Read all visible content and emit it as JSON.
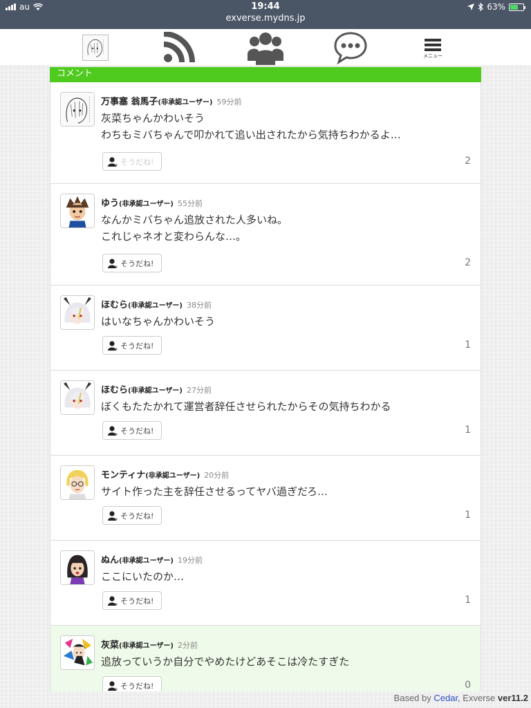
{
  "status_bar": {
    "carrier": "au",
    "time": "19:44",
    "url": "exverse.mydns.jp",
    "battery": "63%",
    "battery_level": 0.63
  },
  "nav": {
    "items": [
      "avatar-icon",
      "rss-icon",
      "users-icon",
      "chat-icon",
      "menu-icon"
    ],
    "menu_label": "メニュー"
  },
  "section": {
    "title": "コメント"
  },
  "comments": [
    {
      "name": "万事塞 翁馬子",
      "role": "(非承認ユーザー)",
      "time": "59分前",
      "line1": "灰菜ちゃんかわいそう",
      "line2": "わちもミバちゃんで叩かれて追い出されたから気持ちわかるよ…",
      "like_label": "そうだね!",
      "likes": "2",
      "avatar": "manga-sketch"
    },
    {
      "name": "ゆう",
      "role": "(非承認ユーザー)",
      "time": "55分前",
      "line1": "なんかミバちゃん追放された人多いね。",
      "line2": "これじゃネオと変わらんな…。",
      "like_label": "そうだね!",
      "likes": "2",
      "avatar": "spiky-hair-boy"
    },
    {
      "name": "ほむら",
      "role": "(非承認ユーザー)",
      "time": "38分前",
      "line1": "はいなちゃんかわいそう",
      "line2": "",
      "like_label": "そうだね!",
      "likes": "1",
      "avatar": "white-hair-bunny"
    },
    {
      "name": "ほむら",
      "role": "(非承認ユーザー)",
      "time": "27分前",
      "line1": "ぼくもたたかれて運営者辞任させられたからその気持ちわかる",
      "line2": "",
      "like_label": "そうだね!",
      "likes": "1",
      "avatar": "white-hair-bunny"
    },
    {
      "name": "モンティナ",
      "role": "(非承認ユーザー)",
      "time": "20分前",
      "line1": "サイト作った主を辞任させるってヤバ過ぎだろ…",
      "line2": "",
      "like_label": "そうだね!",
      "likes": "1",
      "avatar": "blonde-glasses"
    },
    {
      "name": "ぬん",
      "role": "(非承認ユーザー)",
      "time": "19分前",
      "line1": "ここにいたのか…",
      "line2": "",
      "like_label": "そうだね!",
      "likes": "1",
      "avatar": "dark-hair-purple"
    },
    {
      "name": "灰菜",
      "role": "(非承認ユーザー)",
      "time": "2分前",
      "line1": "追放っていうか自分でやめたけどあそこは冷たすぎた",
      "line2": "",
      "like_label": "そうだね!",
      "likes": "0",
      "avatar": "colorful-art"
    }
  ],
  "footer": {
    "based_by": "Based by",
    "cedar": "Cedar",
    "sep": ", Exverse",
    "version": "ver11.2"
  },
  "colors": {
    "accent_green": "#4fca1e",
    "status_bar": "#4a5566",
    "highlight_row": "#effbea",
    "link_blue": "#2a4fbf"
  }
}
